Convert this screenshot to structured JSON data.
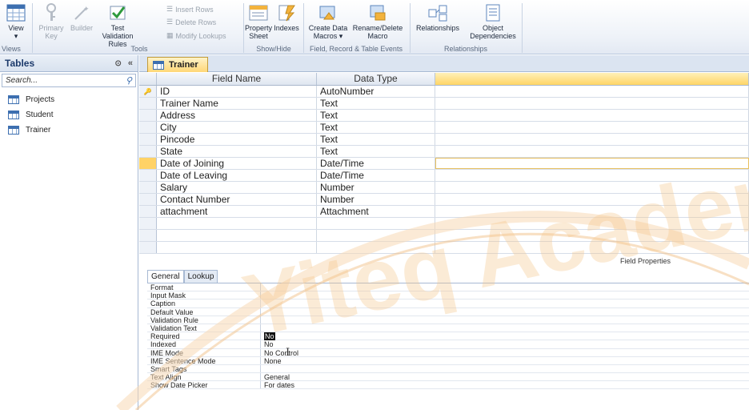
{
  "ribbon": {
    "views_group": {
      "view_label": "View",
      "group_label": "Views"
    },
    "tools_group": {
      "primary_key_label": "Primary Key",
      "builder_label": "Builder",
      "test_validation_label": "Test Validation Rules",
      "insert_rows_label": "Insert Rows",
      "delete_rows_label": "Delete Rows",
      "modify_lookups_label": "Modify Lookups",
      "group_label": "Tools"
    },
    "showhide_group": {
      "property_sheet_label": "Property Sheet",
      "indexes_label": "Indexes",
      "group_label": "Show/Hide"
    },
    "events_group": {
      "create_data_macros_label": "Create Data Macros ▾",
      "rename_delete_macro_label": "Rename/Delete Macro",
      "group_label": "Field, Record & Table Events"
    },
    "relationships_group": {
      "relationships_label": "Relationships",
      "object_dependencies_label": "Object Dependencies",
      "group_label": "Relationships"
    }
  },
  "nav": {
    "title": "Tables",
    "search_placeholder": "Search...",
    "items": [
      {
        "label": "Projects"
      },
      {
        "label": "Student"
      },
      {
        "label": "Trainer"
      }
    ]
  },
  "document": {
    "tab_label": "Trainer",
    "columns": {
      "field_name": "Field Name",
      "data_type": "Data Type",
      "description": ""
    },
    "rows": [
      {
        "field": "ID",
        "type": "AutoNumber",
        "key": true
      },
      {
        "field": "Trainer Name",
        "type": "Text"
      },
      {
        "field": "Address",
        "type": "Text"
      },
      {
        "field": "City",
        "type": "Text"
      },
      {
        "field": "Pincode",
        "type": "Text"
      },
      {
        "field": "State",
        "type": "Text"
      },
      {
        "field": "Date of Joining",
        "type": "Date/Time",
        "selected": true
      },
      {
        "field": "Date of Leaving",
        "type": "Date/Time"
      },
      {
        "field": "Salary",
        "type": "Number"
      },
      {
        "field": "Contact Number",
        "type": "Number"
      },
      {
        "field": "attachment",
        "type": "Attachment"
      }
    ],
    "field_properties_label": "Field Properties"
  },
  "properties": {
    "tabs": [
      {
        "label": "General"
      },
      {
        "label": "Lookup"
      }
    ],
    "rows": [
      {
        "label": "Format",
        "value": ""
      },
      {
        "label": "Input Mask",
        "value": ""
      },
      {
        "label": "Caption",
        "value": ""
      },
      {
        "label": "Default Value",
        "value": ""
      },
      {
        "label": "Validation Rule",
        "value": ""
      },
      {
        "label": "Validation Text",
        "value": ""
      },
      {
        "label": "Required",
        "value": "No",
        "highlight": true
      },
      {
        "label": "Indexed",
        "value": "No"
      },
      {
        "label": "IME Mode",
        "value": "No Control"
      },
      {
        "label": "IME Sentence Mode",
        "value": "None"
      },
      {
        "label": "Smart Tags",
        "value": ""
      },
      {
        "label": "Text Align",
        "value": "General"
      },
      {
        "label": "Show Date Picker",
        "value": "For dates"
      }
    ]
  },
  "watermark_text": "Yiteq Academy"
}
